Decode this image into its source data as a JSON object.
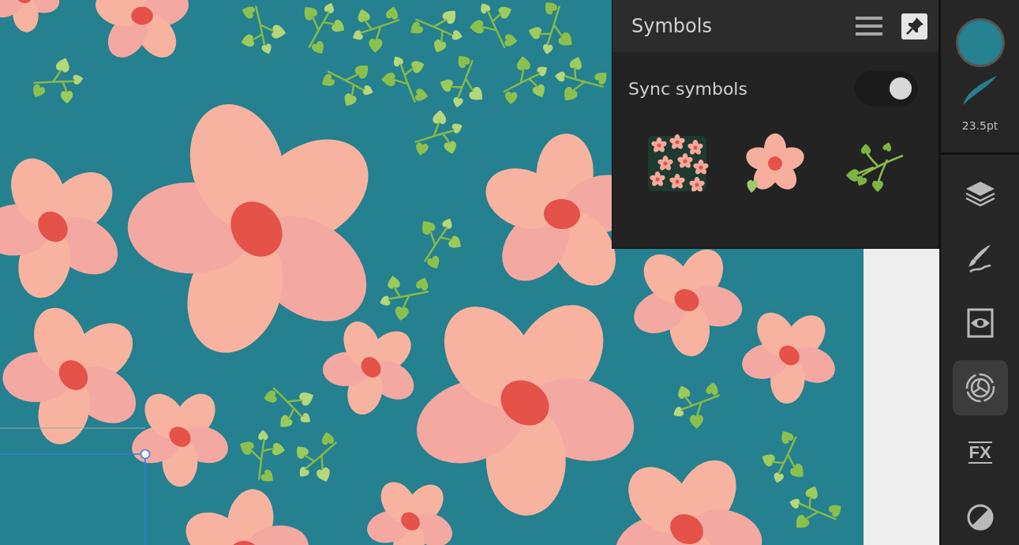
{
  "symbols_panel": {
    "title": "Symbols",
    "sync": {
      "label": "Sync symbols",
      "on": true
    },
    "symbols": [
      {
        "kind": "cluster"
      },
      {
        "kind": "flower"
      },
      {
        "kind": "sprig"
      }
    ]
  },
  "toolbar": {
    "brush_size": "23.5pt",
    "studios": [
      {
        "kind": "layers",
        "selected": false
      },
      {
        "kind": "brushes",
        "selected": false
      },
      {
        "kind": "appearance",
        "selected": false
      },
      {
        "kind": "symbols",
        "selected": true
      },
      {
        "kind": "fx",
        "label": "FX",
        "selected": false
      },
      {
        "kind": "adjust",
        "selected": false
      }
    ]
  }
}
